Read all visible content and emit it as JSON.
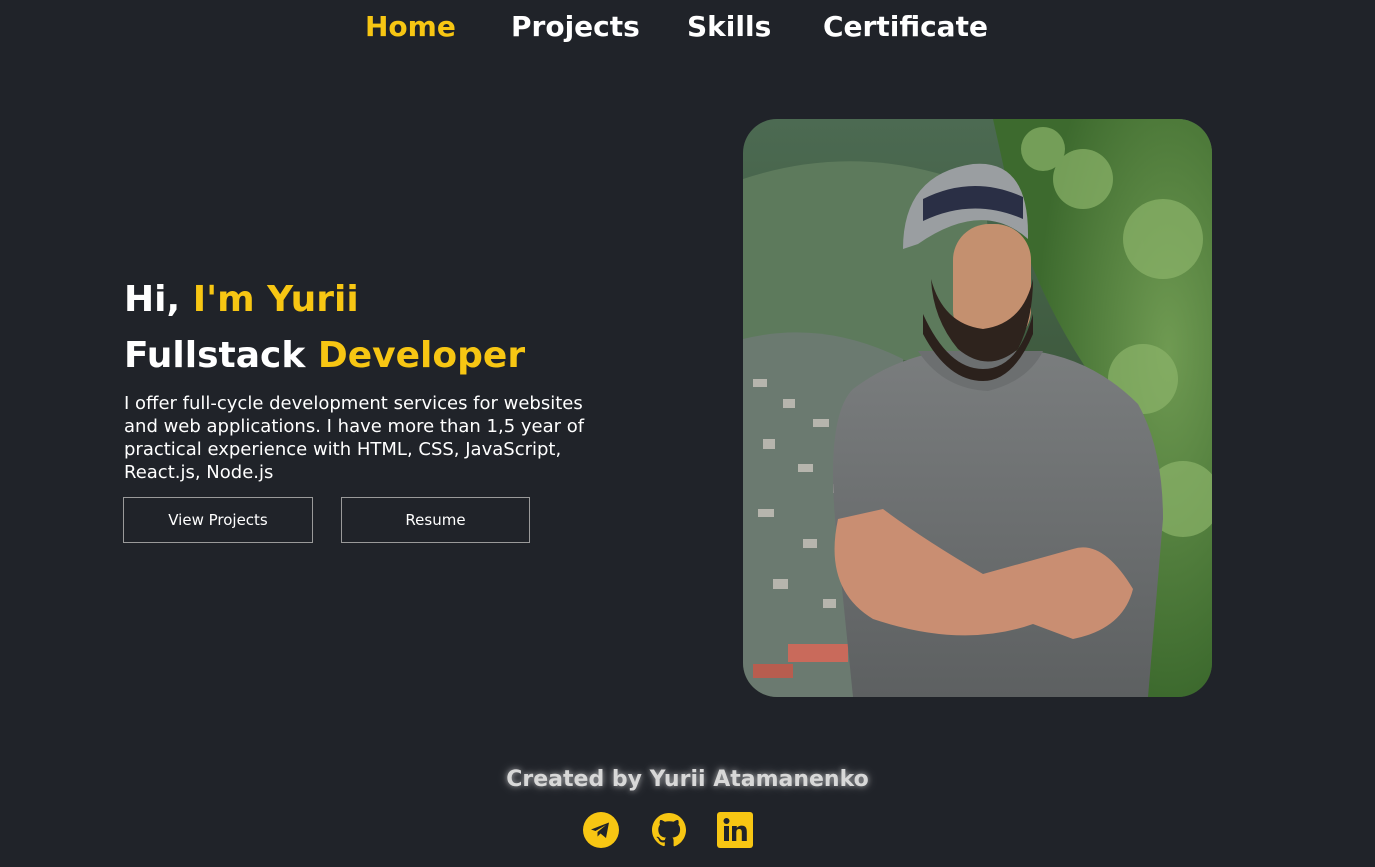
{
  "nav": {
    "items": [
      {
        "label": "Home",
        "active": true
      },
      {
        "label": "Projects",
        "active": false
      },
      {
        "label": "Skills",
        "active": false
      },
      {
        "label": "Certificate",
        "active": false
      }
    ]
  },
  "hero": {
    "greeting": "Hi,",
    "name": "I'm Yurii",
    "role_first": "Fullstack",
    "role_accent": "Developer",
    "description": "I offer full-cycle development services for websites and web applications. I have more than 1,5 year of practical experience with HTML, CSS, JavaScript, React.js, Node.js",
    "buttons": {
      "view_projects": "View Projects",
      "resume": "Resume"
    }
  },
  "footer": {
    "credit": "Created by Yurii Atamanenko",
    "social_icons": [
      "telegram-icon",
      "github-icon",
      "linkedin-icon"
    ]
  },
  "colors": {
    "background": "#202329",
    "accent": "#f7c613",
    "text": "#ffffff"
  }
}
